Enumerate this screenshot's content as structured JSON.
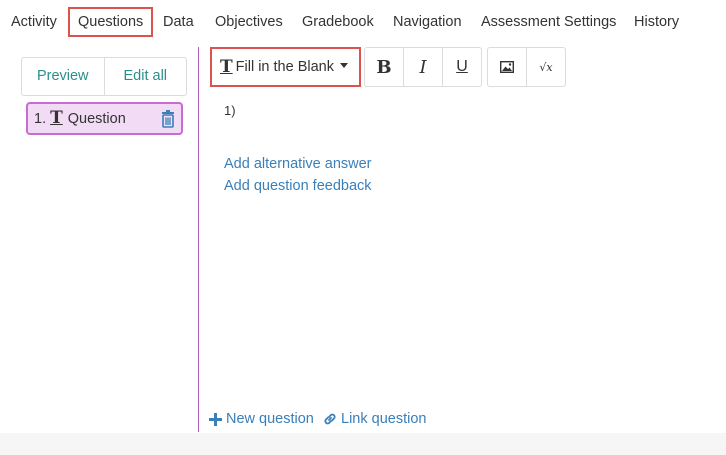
{
  "topnav": {
    "tabs": [
      {
        "label": "Activity",
        "active": false
      },
      {
        "label": "Questions",
        "active": true
      },
      {
        "label": "Data",
        "active": false
      },
      {
        "label": "Objectives",
        "active": false
      },
      {
        "label": "Gradebook",
        "active": false
      },
      {
        "label": "Navigation",
        "active": false
      },
      {
        "label": "Assessment Settings",
        "active": false
      },
      {
        "label": "History",
        "active": false
      }
    ]
  },
  "left_panel": {
    "preview_label": "Preview",
    "edit_all_label": "Edit all",
    "questions": [
      {
        "number": "1.",
        "type_icon": "T",
        "label": "Question"
      }
    ]
  },
  "toolbar": {
    "question_type_icon": "T",
    "question_type": "Fill in the Blank",
    "bold_label": "B",
    "italic_label": "I",
    "underline_label": "U",
    "image_icon": "image-icon",
    "math_icon": "sqrt-icon",
    "math_label": "√x"
  },
  "editor": {
    "answer_number": "1)",
    "add_alternative_answer": "Add alternative answer",
    "add_question_feedback": "Add question feedback"
  },
  "footer": {
    "new_question": "New question",
    "link_question": "Link question"
  },
  "colors": {
    "active_border": "#d9534f",
    "selected_item_bg": "#f2dcf5",
    "selected_item_border": "#c86cd2",
    "link": "#3a7fb8",
    "teal_button_text": "#2a8f8c"
  }
}
